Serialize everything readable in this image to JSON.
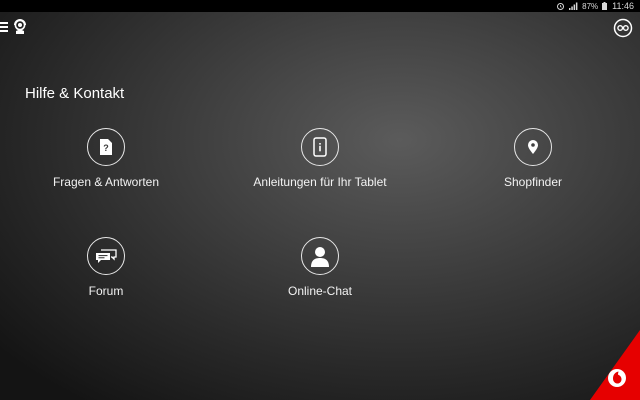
{
  "status_bar": {
    "battery_percent": "87%",
    "time": "11:46",
    "icons": [
      "alarm-icon",
      "signal-icon",
      "battery-icon"
    ]
  },
  "top_bar": {
    "icons": [
      "menu-icon",
      "support-icon",
      "account-icon"
    ]
  },
  "page": {
    "title": "Hilfe & Kontakt"
  },
  "tiles": [
    {
      "label": "Fragen & Antworten",
      "icon": "faq-document-icon"
    },
    {
      "label": "Anleitungen für Ihr Tablet",
      "icon": "tablet-info-icon"
    },
    {
      "label": "Shopfinder",
      "icon": "location-pin-icon"
    },
    {
      "label": "Forum",
      "icon": "chat-bubbles-icon"
    },
    {
      "label": "Online-Chat",
      "icon": "person-icon"
    }
  ],
  "colors": {
    "brand_red": "#e60000",
    "icon_stroke": "#e6e6e6",
    "text": "#ffffff"
  }
}
